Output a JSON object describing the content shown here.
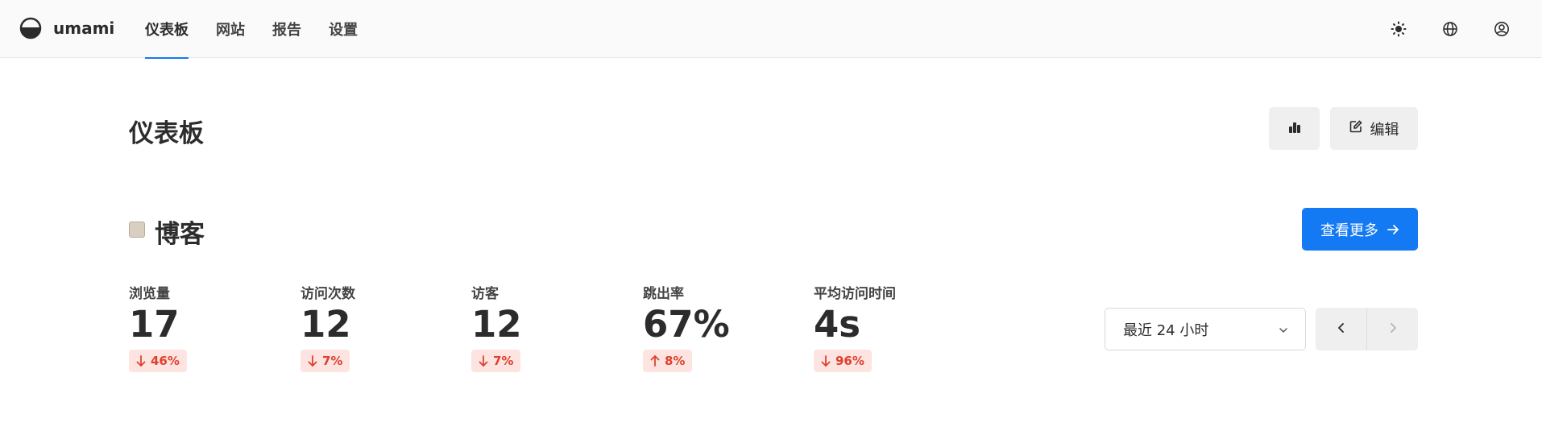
{
  "app": {
    "brand": "umami"
  },
  "nav": {
    "items": [
      {
        "label": "仪表板",
        "active": true
      },
      {
        "label": "网站",
        "active": false
      },
      {
        "label": "报告",
        "active": false
      },
      {
        "label": "设置",
        "active": false
      }
    ]
  },
  "header_icons": [
    "sun-icon",
    "globe-icon",
    "user-icon"
  ],
  "page": {
    "title": "仪表板",
    "edit_label": "编辑"
  },
  "website": {
    "name": "博客",
    "view_more_label": "查看更多",
    "metrics": [
      {
        "label": "浏览量",
        "value": "17",
        "change": "46%",
        "direction": "down"
      },
      {
        "label": "访问次数",
        "value": "12",
        "change": "7%",
        "direction": "down"
      },
      {
        "label": "访客",
        "value": "12",
        "change": "7%",
        "direction": "down"
      },
      {
        "label": "跳出率",
        "value": "67%",
        "change": "8%",
        "direction": "up"
      },
      {
        "label": "平均访问时间",
        "value": "4s",
        "change": "96%",
        "direction": "down"
      }
    ]
  },
  "filters": {
    "date_range": "最近 24 小时"
  },
  "colors": {
    "accent": "#147af3",
    "negative": "#e0402d",
    "negative_bg": "#fde4e1"
  }
}
